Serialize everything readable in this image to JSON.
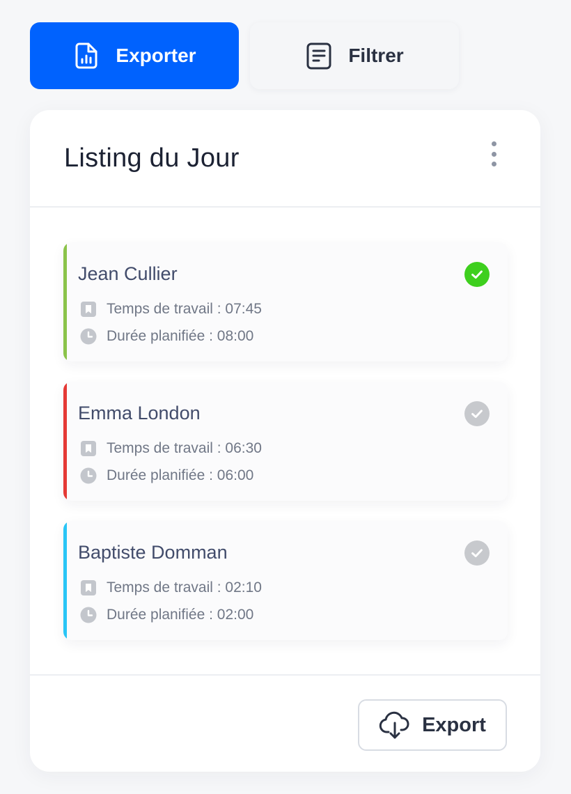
{
  "toolbar": {
    "export_label": "Exporter",
    "filter_label": "Filtrer",
    "export_color": "#0062fe"
  },
  "card": {
    "title": "Listing du Jour"
  },
  "items": [
    {
      "name": "Jean Cullier",
      "work_time": "Temps de travail : 07:45",
      "planned": "Durée planifiée : 08:00",
      "bar_color": "#8bc34a",
      "status": "done",
      "check_color": "#3ecf1e"
    },
    {
      "name": "Emma London",
      "work_time": "Temps de travail : 06:30",
      "planned": "Durée planifiée : 06:00",
      "bar_color": "#e53935",
      "status": "pending",
      "check_color": "#c7c9cd"
    },
    {
      "name": "Baptiste Domman",
      "work_time": "Temps de travail : 02:10",
      "planned": "Durée planifiée : 02:00",
      "bar_color": "#29c5f6",
      "status": "pending",
      "check_color": "#c7c9cd"
    }
  ],
  "footer": {
    "export_label": "Export"
  },
  "icons": {
    "export_top": "file-chart-icon",
    "filter_top": "document-list-icon",
    "more": "more-vertical-icon",
    "work_time": "bookmark-icon",
    "planned": "clock-icon",
    "status": "check-circle-icon",
    "export_bottom": "cloud-download-icon"
  }
}
